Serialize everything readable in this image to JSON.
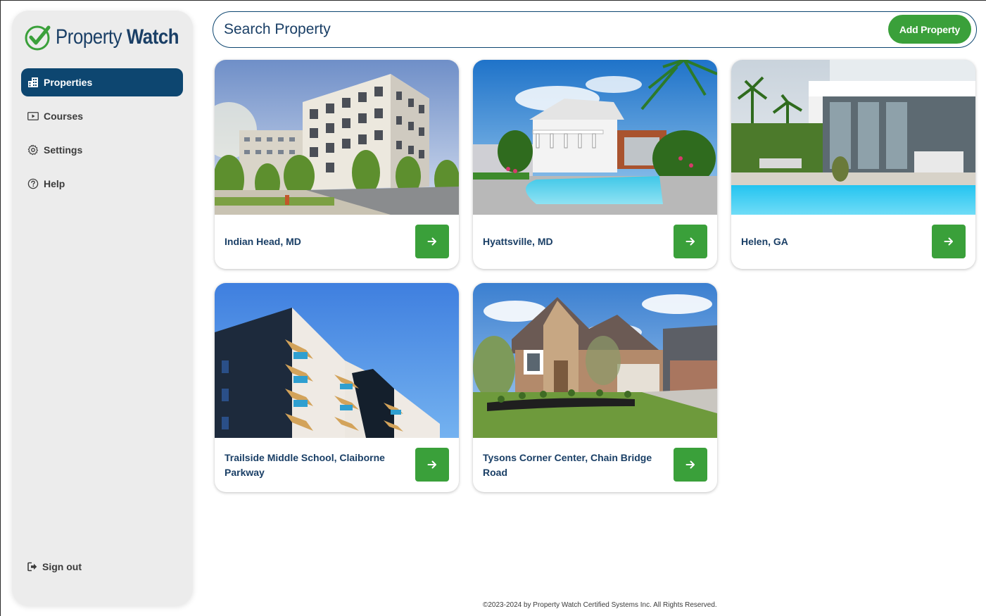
{
  "app": {
    "logo_text_regular": "Property",
    "logo_text_bold": "Watch",
    "brand_colors": {
      "navy": "#0d4670",
      "green": "#3aa03a"
    }
  },
  "sidebar": {
    "items": [
      {
        "label": "Properties",
        "icon": "building-icon",
        "active": true
      },
      {
        "label": "Courses",
        "icon": "play-icon",
        "active": false
      },
      {
        "label": "Settings",
        "icon": "gear-icon",
        "active": false
      },
      {
        "label": "Help",
        "icon": "question-circle-icon",
        "active": false
      }
    ],
    "signout_label": "Sign out",
    "signout_icon": "sign-out-icon"
  },
  "search": {
    "placeholder": "Search Property",
    "value": "",
    "icon": "arrow-right-icon"
  },
  "toolbar": {
    "add_property_label": "Add Property"
  },
  "properties": [
    {
      "name": "Indian Head, MD",
      "image": "modern apartment building photo"
    },
    {
      "name": "Hyattsville, MD",
      "image": "house with swimming pool photo"
    },
    {
      "name": "Helen, GA",
      "image": "modern villa with pool photo"
    },
    {
      "name": "Trailside Middle School, Claiborne Parkway",
      "image": "apartment building with balconies photo"
    },
    {
      "name": "Tysons Corner Center, Chain Bridge Road",
      "image": "brick suburban house photo"
    }
  ],
  "footer": {
    "copyright": "©2023-2024 by Property Watch Certified Systems Inc. All Rights Reserved."
  }
}
